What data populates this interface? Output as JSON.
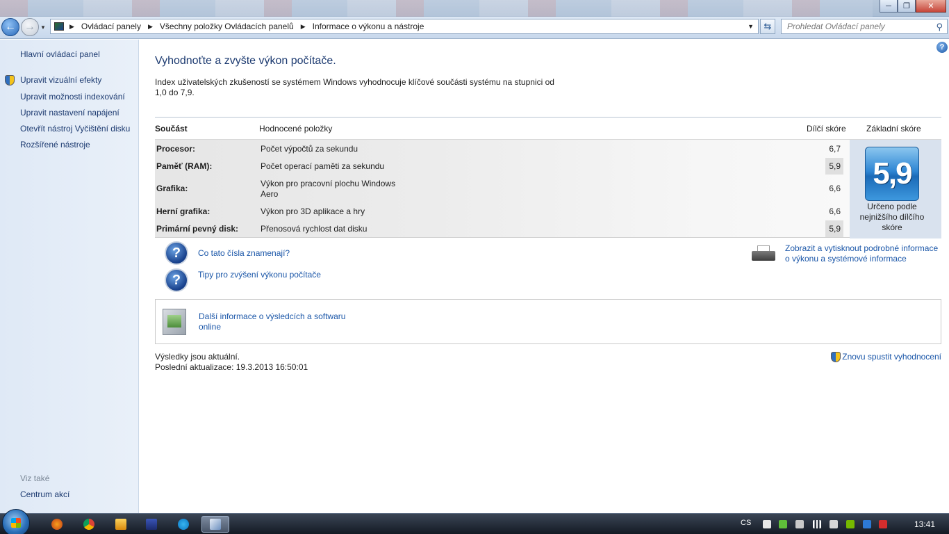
{
  "window": {
    "minimize": "─",
    "maximize": "❐",
    "close": "✕"
  },
  "address": {
    "crumbs": [
      "Ovládací panely",
      "Všechny položky Ovládacích panelů",
      "Informace o výkonu a nástroje"
    ],
    "search_placeholder": "Prohledat Ovládací panely"
  },
  "sidebar": {
    "home": "Hlavní ovládací panel",
    "links": [
      {
        "label": "Upravit vizuální efekty",
        "shield": true
      },
      {
        "label": "Upravit možnosti indexování",
        "shield": false
      },
      {
        "label": "Upravit nastavení napájení",
        "shield": false
      },
      {
        "label": "Otevřít nástroj Vyčištění disku",
        "shield": false
      },
      {
        "label": "Rozšířené nástroje",
        "shield": false
      }
    ],
    "see_also": "Viz také",
    "see_also_links": [
      "Centrum akcí"
    ]
  },
  "main": {
    "title": "Vyhodnoťte a zvyšte výkon počítače.",
    "description": "Index uživatelských zkušeností se systémem Windows vyhodnocuje klíčové součásti systému na stupnici od 1,0 do 7,9.",
    "table": {
      "headers": {
        "component": "Součást",
        "rated": "Hodnocené položky",
        "subscore": "Dílčí skóre",
        "basescore": "Základní skóre"
      },
      "rows": [
        {
          "component": "Procesor:",
          "rated": "Počet výpočtů za sekundu",
          "score": "6,7",
          "lowest": false
        },
        {
          "component": "Paměť (RAM):",
          "rated": "Počet operací paměti za sekundu",
          "score": "5,9",
          "lowest": true
        },
        {
          "component": "Grafika:",
          "rated": "Výkon pro pracovní plochu Windows Aero",
          "score": "6,6",
          "lowest": false
        },
        {
          "component": "Herní grafika:",
          "rated": "Výkon pro 3D aplikace a hry",
          "score": "6,6",
          "lowest": false
        },
        {
          "component": "Primární pevný disk:",
          "rated": "Přenosová rychlost dat disku",
          "score": "5,9",
          "lowest": true
        }
      ],
      "base_score": "5,9",
      "base_caption": "Určeno podle nejnižšího dílčího skóre"
    },
    "links": {
      "what_mean": "Co tato čísla znamenají?",
      "tips": "Tipy pro zvýšení výkonu počítače",
      "print_details": "Zobrazit a vytisknout podrobné informace o výkonu a systémové informace",
      "more_info": "Další informace o výsledcích a softwaru online"
    },
    "status": {
      "current": "Výsledky jsou aktuální.",
      "last_update": "Poslední aktualizace: 19.3.2013 16:50:01"
    },
    "rerun": "Znovu spustit vyhodnocení"
  },
  "taskbar": {
    "apps": [
      "firefox-icon",
      "chrome-icon",
      "media-player-icon",
      "save-icon",
      "skype-icon",
      "control-panel-icon"
    ],
    "language": "CS",
    "time": "13:41"
  },
  "colors": {
    "link": "#1a56a8",
    "heading": "#1c3a70",
    "badge": "#2e86d4"
  }
}
